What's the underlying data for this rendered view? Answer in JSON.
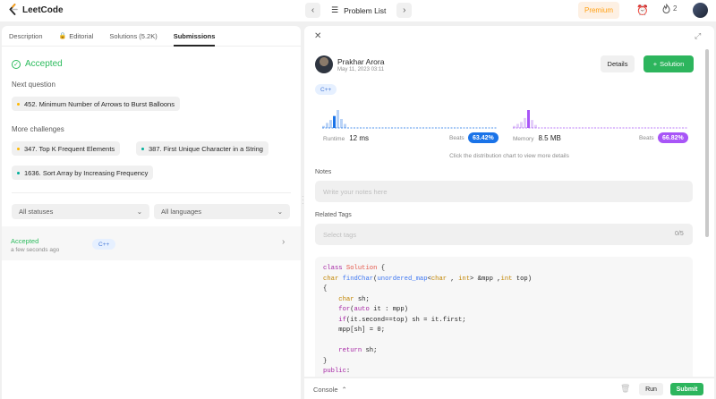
{
  "header": {
    "logo_text": "LeetCode",
    "problem_list": "Problem List",
    "premium": "Premium",
    "streak_count": "2"
  },
  "left": {
    "tabs": [
      {
        "label": "Description"
      },
      {
        "label": "Editorial"
      },
      {
        "label": "Solutions (5.2K)"
      },
      {
        "label": "Submissions"
      }
    ],
    "accepted_label": "Accepted",
    "next_question_label": "Next question",
    "next_question": "452. Minimum Number of Arrows to Burst Balloons",
    "more_challenges_label": "More challenges",
    "challenges": [
      {
        "title": "347. Top K Frequent Elements",
        "difficulty": "medium"
      },
      {
        "title": "387. First Unique Character in a String",
        "difficulty": "easy"
      },
      {
        "title": "1636. Sort Array by Increasing Frequency",
        "difficulty": "easy"
      }
    ],
    "status_select": "All statuses",
    "language_select": "All languages",
    "submission": {
      "status": "Accepted",
      "time": "a few seconds ago",
      "language": "C++"
    }
  },
  "right": {
    "author": "Prakhar Arora",
    "date": "May 11, 2023 03:11",
    "details_label": "Details",
    "solution_label": "Solution",
    "language": "C++",
    "runtime_label": "Runtime",
    "runtime_value": "12 ms",
    "memory_label": "Memory",
    "memory_value": "8.5 MB",
    "beats_label": "Beats",
    "runtime_beats": "63.42%",
    "memory_beats": "66.82%",
    "hint": "Click the distribution chart to view more details",
    "notes_label": "Notes",
    "notes_placeholder": "Write your notes here",
    "tags_label": "Related Tags",
    "tags_placeholder": "Select tags",
    "tags_count": "0/5",
    "code_lines": [
      "class Solution {",
      "char findChar(unordered_map<char , int> &mpp ,int top)",
      "{",
      "    char sh;",
      "    for(auto it : mpp)",
      "    if(it.second==top) sh = it.first;",
      "    mpp[sh] = 0;",
      "",
      "    return sh;",
      "}",
      "public:"
    ]
  },
  "bottom": {
    "console": "Console",
    "run": "Run",
    "submit": "Submit"
  },
  "colors": {
    "accent_green": "#2cbb5d",
    "runtime_blue": "#1a73e8",
    "memory_purple": "#a855f7",
    "premium_orange": "#ffa116"
  },
  "chart_data": [
    {
      "type": "bar",
      "title": "",
      "metric": "Runtime",
      "values": [
        2,
        5,
        8,
        12,
        18,
        9,
        4
      ],
      "highlight_index": 3
    },
    {
      "type": "bar",
      "title": "",
      "metric": "Memory",
      "values": [
        2,
        4,
        6,
        10,
        18,
        8,
        3
      ],
      "highlight_index": 4
    }
  ]
}
